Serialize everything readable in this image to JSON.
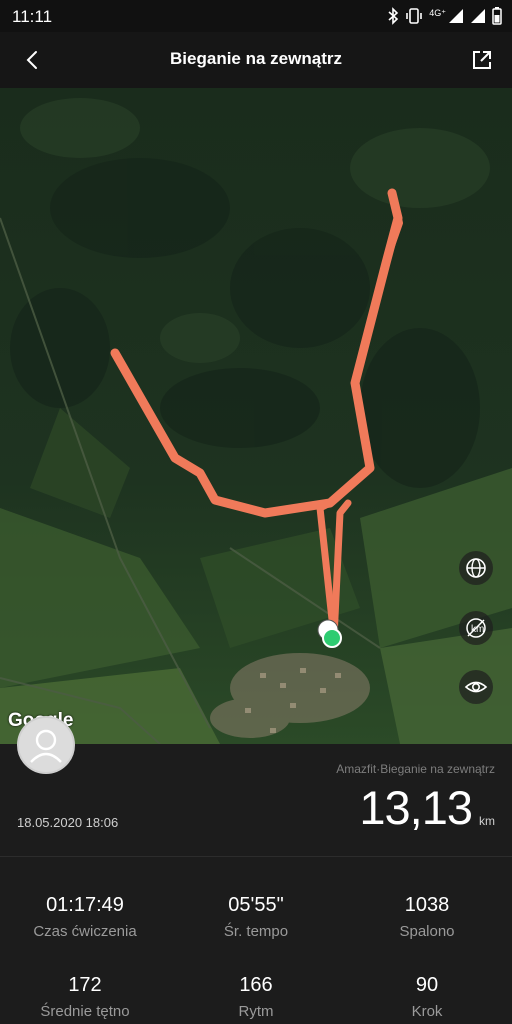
{
  "status_bar": {
    "time": "11:11",
    "network": "4G⁺"
  },
  "header": {
    "title": "Bieganie na zewnątrz"
  },
  "map": {
    "attribution": "Google"
  },
  "summary": {
    "source": "Amazfit·Bieganie na zewnątrz",
    "date": "18.05.2020 18:06",
    "distance": "13,13",
    "distance_unit": "km"
  },
  "stats": [
    {
      "value": "01:17:49",
      "label": "Czas ćwiczenia"
    },
    {
      "value": "05'55\"",
      "label": "Śr. tempo"
    },
    {
      "value": "1038",
      "label": "Spalono"
    },
    {
      "value": "172",
      "label": "Średnie tętno"
    },
    {
      "value": "166",
      "label": "Rytm"
    },
    {
      "value": "90",
      "label": "Krok"
    }
  ],
  "colors": {
    "route": "#f07a5a",
    "start_dot": "#2ecc71",
    "background": "#1c1c1c"
  },
  "icons": [
    "bluetooth-icon",
    "vibrate-icon",
    "signal-icon",
    "battery-icon",
    "back-arrow-icon",
    "share-icon",
    "globe-icon",
    "km-markers-off-icon",
    "eye-icon",
    "user-avatar-icon"
  ]
}
